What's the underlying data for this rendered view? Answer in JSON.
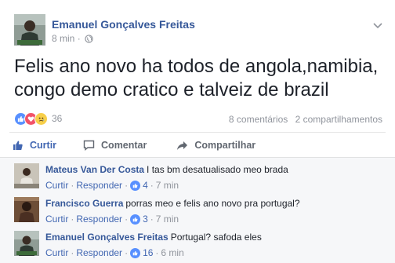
{
  "post": {
    "author": "Emanuel Gonçalves Freitas",
    "time": "8 min",
    "meta_separator": "·",
    "text": "Felis ano novo ha todos de angola,namibia, congo demo cratico e talveiz de brazil",
    "reaction_count": "36",
    "comments_count": "8 comentários",
    "shares_count": "2 compartilhamentos",
    "reaction_icons": [
      "like-icon",
      "love-icon",
      "sad-icon"
    ]
  },
  "actions": {
    "like": "Curtir",
    "comment": "Comentar",
    "share": "Compartilhar"
  },
  "comments": [
    {
      "author": "Mateus Van Der Costa",
      "text": "I tas bm desatualisado meo brada",
      "like_label": "Curtir",
      "reply_label": "Responder",
      "likes": "4",
      "time": "7 min",
      "sep": "·"
    },
    {
      "author": "Francisco Guerra",
      "text": "porras meo e felis ano novo pra portugal?",
      "like_label": "Curtir",
      "reply_label": "Responder",
      "likes": "3",
      "time": "7 min",
      "sep": "·"
    },
    {
      "author": "Emanuel Gonçalves Freitas",
      "text": "Portugal? safoda eles",
      "like_label": "Curtir",
      "reply_label": "Responder",
      "likes": "16",
      "time": "6 min",
      "sep": "·"
    }
  ],
  "colors": {
    "link_blue": "#365899",
    "action_blue": "#4267b2",
    "meta_gray": "#90949c",
    "like_blue": "#5890ff",
    "love_red": "#f25268",
    "sad_yellow": "#f7cf4a"
  }
}
